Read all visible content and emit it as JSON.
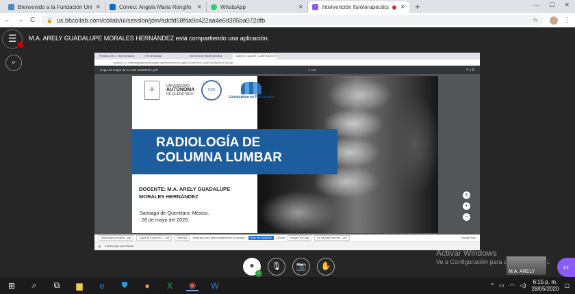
{
  "tabs": [
    {
      "title": "Bienvenido a la Fundación Unive",
      "color": "#4a8ac7",
      "active": false
    },
    {
      "title": "Correo: Angela Maria Rengifo Te",
      "color": "#0f6cbd",
      "active": false
    },
    {
      "title": "WhatsApp",
      "color": "#25d366",
      "active": false
    },
    {
      "title": "Intervención fisioterapeutica",
      "color": "#8b5cf6",
      "active": true
    }
  ],
  "new_tab": "+",
  "window_controls": {
    "minimize": "—",
    "maximize": "☐",
    "close": "✕"
  },
  "address": {
    "url": "us.bbcollab.com/collab/ui/session/join/adcfd58fda9c422aa4e6d385ba072dfb",
    "lock": "🔒"
  },
  "nav": {
    "back": "←",
    "forward": "→",
    "reload": "C",
    "star": "☆",
    "menu": "⋮"
  },
  "share_message": "M.A. ARELY GUADALUPE MORALES HERNÁNDEZ está compartiendo una aplicación.",
  "inner": {
    "tabs": [
      "Pedidos (383) - Manimaraparo",
      "(78) WhatsApp",
      "Intervención fisioterapéutica",
      "Clase de Copia de CLASE MUESTRA"
    ],
    "address": "Archivo | C:/Users/ayuta/Downloads/Copia%20de%20Copia%20de%20CLASE%20MUESTRA.pdf",
    "pdf_title": "Copia de Copia de CLASE MUESTRA.pdf",
    "pdf_pages": "1 / 23",
    "notif": "collab.bbc.com está compartiendo tu pantalla.",
    "notif_stop": "Dejar de compartir",
    "notif_hide": "Ocultar",
    "taskbar_search": "Escribe aquí para buscar",
    "downloads": [
      "Radiología lumbaria....pdf",
      "Copia de Copia de C...pdf",
      "rafiel.jpg",
      "Imagen IMG.jpg",
      "Es Sacralia Savvirtu....pdf"
    ],
    "show_all": "Mostrar todo"
  },
  "slide": {
    "uaq_small": "UNIVERSIDAD",
    "uaq_big": "AUTÓNOMA",
    "uaq_city": "DE QUERÉTARO",
    "fisio_mark": "CRD",
    "lic_name": "Licenciatura en Fisioterapia",
    "title_line1": "RADIOLOGÍA DE",
    "title_line2": "COLUMNA LUMBAR",
    "docente_line1": "DOCENTE: M.A. ARELY GUADALUPE",
    "docente_line2": "MORALES HERNÁNDEZ",
    "place": "Santiago de Querétaro, México.",
    "date": "28 de mayo del 2020."
  },
  "controls": {
    "avatar": "●",
    "mic": "🎙",
    "camera": "📷",
    "hand": "✋",
    "ok": "✓"
  },
  "watermark": {
    "line1": "Activar Windows",
    "line2": "Ve a Configuración para activar Windows."
  },
  "pip_name": "M.A. ARELY",
  "taskbar": {
    "clock": "6:15 p. m.",
    "date": "28/05/2020"
  }
}
